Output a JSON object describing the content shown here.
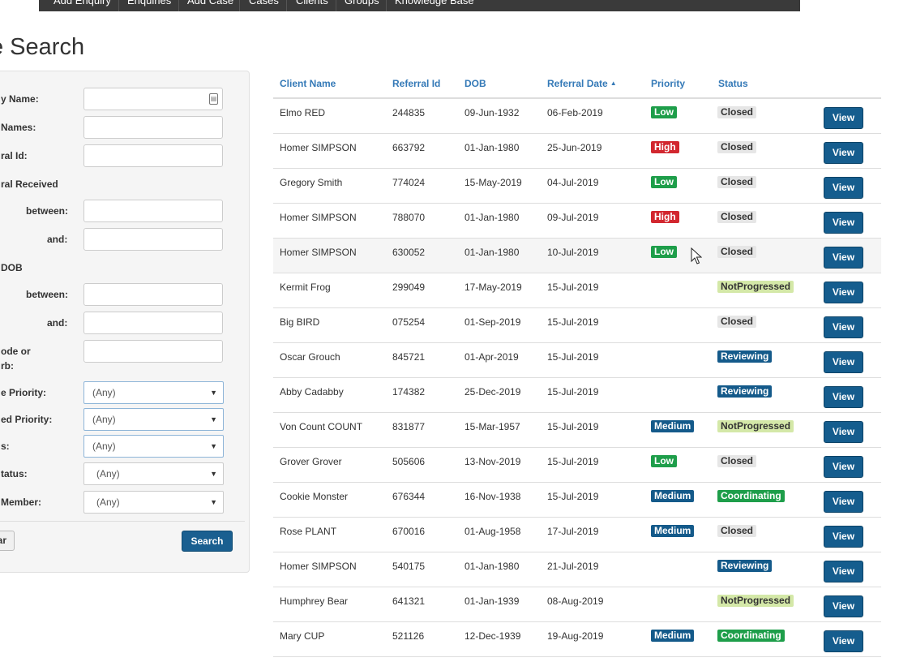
{
  "nav": {
    "items": [
      "Add Enquiry",
      "Enquiries",
      "Add Case",
      "Cases",
      "Clients",
      "Groups",
      "Knowledge Base"
    ]
  },
  "page": {
    "title": "e Search"
  },
  "filters": {
    "labels": [
      "y Name:",
      " Names:",
      "ral Id:",
      "ral Received",
      "between:",
      "and:",
      " DOB",
      "between:",
      "and:",
      "ode or",
      "rb:",
      "e Priority:",
      "ed Priority:",
      "s:",
      "tatus:",
      "Member:"
    ],
    "selects": [
      "(Any)",
      "(Any)",
      "(Any)",
      "(Any)",
      "(Any)"
    ],
    "clear_label": "ar",
    "search_label": "Search"
  },
  "table": {
    "headers": [
      "Client Name",
      "Referral Id",
      "DOB",
      "Referral Date",
      "Priority",
      "Status"
    ],
    "view_label": "View",
    "rows": [
      {
        "name": "Elmo RED",
        "id": "244835",
        "dob": "09-Jun-1932",
        "date": "06-Feb-2019",
        "priority": "Low",
        "status": "Closed"
      },
      {
        "name": "Homer SIMPSON",
        "id": "663792",
        "dob": "01-Jan-1980",
        "date": "25-Jun-2019",
        "priority": "High",
        "status": "Closed"
      },
      {
        "name": "Gregory Smith",
        "id": "774024",
        "dob": "15-May-2019",
        "date": "04-Jul-2019",
        "priority": "Low",
        "status": "Closed"
      },
      {
        "name": "Homer SIMPSON",
        "id": "788070",
        "dob": "01-Jan-1980",
        "date": "09-Jul-2019",
        "priority": "High",
        "status": "Closed"
      },
      {
        "name": "Homer SIMPSON",
        "id": "630052",
        "dob": "01-Jan-1980",
        "date": "10-Jul-2019",
        "priority": "Low",
        "status": "Closed"
      },
      {
        "name": "Kermit Frog",
        "id": "299049",
        "dob": "17-May-2019",
        "date": "15-Jul-2019",
        "priority": "",
        "status": "NotProgressed"
      },
      {
        "name": "Big BIRD",
        "id": "075254",
        "dob": "01-Sep-2019",
        "date": "15-Jul-2019",
        "priority": "",
        "status": "Closed"
      },
      {
        "name": "Oscar Grouch",
        "id": "845721",
        "dob": "01-Apr-2019",
        "date": "15-Jul-2019",
        "priority": "",
        "status": "Reviewing"
      },
      {
        "name": "Abby Cadabby",
        "id": "174382",
        "dob": "25-Dec-2019",
        "date": "15-Jul-2019",
        "priority": "",
        "status": "Reviewing"
      },
      {
        "name": "Von Count COUNT",
        "id": "831877",
        "dob": "15-Mar-1957",
        "date": "15-Jul-2019",
        "priority": "Medium",
        "status": "NotProgressed"
      },
      {
        "name": "Grover Grover",
        "id": "505606",
        "dob": "13-Nov-2019",
        "date": "15-Jul-2019",
        "priority": "Low",
        "status": "Closed"
      },
      {
        "name": "Cookie Monster",
        "id": "676344",
        "dob": "16-Nov-1938",
        "date": "15-Jul-2019",
        "priority": "Medium",
        "status": "Coordinating"
      },
      {
        "name": "Rose PLANT",
        "id": "670016",
        "dob": "01-Aug-1958",
        "date": "17-Jul-2019",
        "priority": "Medium",
        "status": "Closed"
      },
      {
        "name": "Homer SIMPSON",
        "id": "540175",
        "dob": "01-Jan-1980",
        "date": "21-Jul-2019",
        "priority": "",
        "status": "Reviewing"
      },
      {
        "name": "Humphrey Bear",
        "id": "641321",
        "dob": "01-Jan-1939",
        "date": "08-Aug-2019",
        "priority": "",
        "status": "NotProgressed"
      },
      {
        "name": "Mary CUP",
        "id": "521126",
        "dob": "12-Dec-1939",
        "date": "19-Aug-2019",
        "priority": "Medium",
        "status": "Coordinating"
      }
    ]
  },
  "colors": {
    "nav_bg": "#3a3a3a",
    "header_link": "#3479b7",
    "view_button": "#155d8e",
    "low": "#1e9e4a",
    "high": "#d2272f",
    "medium": "#145a8a",
    "closed": "#e6e6e6",
    "not_progressed": "#d4e8a8",
    "reviewing": "#145a8a",
    "coordinating": "#1e9e4a"
  },
  "icons": {
    "contact": "contact-card-icon",
    "sort": "sort-ascending-icon",
    "caret": "chevron-down-icon",
    "cursor": "mouse-pointer-icon"
  }
}
